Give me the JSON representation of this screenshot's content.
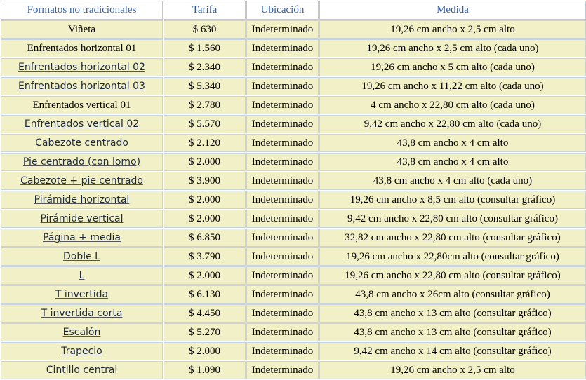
{
  "headers": [
    "Formatos no tradicionales",
    "Tarifa",
    "Ubicación",
    "Medida"
  ],
  "rows": [
    {
      "name": "Viñeta",
      "linked": false,
      "price": "$ 630",
      "location": "Indeterminado",
      "size": "19,26 cm ancho x 2,5 cm alto"
    },
    {
      "name": "Enfrentados horizontal 01",
      "linked": false,
      "price": "$ 1.560",
      "location": "Indeterminado",
      "size": "19,26 cm ancho x 2,5 cm alto (cada uno)"
    },
    {
      "name": "Enfrentados horizontal 02",
      "linked": true,
      "price": "$ 2.340",
      "location": "Indeterminado",
      "size": "19,26 cm ancho x 5 cm alto (cada uno)"
    },
    {
      "name": "Enfrentados horizontal 03",
      "linked": true,
      "price": "$ 5.340",
      "location": "Indeterminado",
      "size": "19,26 cm ancho x 11,22 cm alto (cada uno)"
    },
    {
      "name": "Enfrentados vertical 01",
      "linked": false,
      "price": "$ 2.780",
      "location": "Indeterminado",
      "size": "4 cm ancho x 22,80 cm alto (cada uno)"
    },
    {
      "name": "Enfrentados vertical 02",
      "linked": true,
      "price": "$ 5.570",
      "location": "Indeterminado",
      "size": "9,42 cm ancho x 22,80 cm alto (cada uno)"
    },
    {
      "name": "Cabezote centrado",
      "linked": true,
      "price": "$ 2.120",
      "location": "Indeterminado",
      "size": "43,8 cm ancho x 4 cm alto"
    },
    {
      "name": "Pie centrado (con lomo)",
      "linked": true,
      "price": "$ 2.000",
      "location": "Indeterminado",
      "size": "43,8 cm ancho x 4 cm alto"
    },
    {
      "name": "Cabezote + pie centrado",
      "linked": true,
      "price": "$ 3.900",
      "location": "Indeterminado",
      "size": "43,8 cm ancho x 4 cm alto (cada uno)"
    },
    {
      "name": "Pirámide horizontal",
      "linked": true,
      "price": "$ 2.000",
      "location": "Indeterminado",
      "size": "19,26 cm ancho x 8,5 cm alto (consultar gráfico)"
    },
    {
      "name": "Pirámide vertical",
      "linked": true,
      "price": "$ 2.000",
      "location": "Indeterminado",
      "size": "9,42 cm ancho x 22,80 cm alto (consultar gráfico)"
    },
    {
      "name": "Página + media",
      "linked": true,
      "price": "$ 6.850",
      "location": "Indeterminado",
      "size": "32,82 cm ancho x 22,80 cm alto (consultar gráfico)"
    },
    {
      "name": "Doble L",
      "linked": true,
      "price": "$ 3.790",
      "location": "Indeterminado",
      "size": "19,26 cm ancho x 22,80cm alto (consultar gráfico)"
    },
    {
      "name": "L",
      "linked": true,
      "price": "$ 2.000",
      "location": "Indeterminado",
      "size": "19,26 cm ancho x 22,80 cm alto (consultar gráfico)"
    },
    {
      "name": "T invertida",
      "linked": true,
      "price": "$ 6.130",
      "location": "Indeterminado",
      "size": "43,8 cm ancho x 26cm alto (consultar gráfico)"
    },
    {
      "name": "T invertida corta",
      "linked": true,
      "price": "$ 4.450",
      "location": "Indeterminado",
      "size": "43,8 cm ancho x 13 cm alto (consultar gráfico)"
    },
    {
      "name": "Escalón",
      "linked": true,
      "price": "$ 5.270",
      "location": "Indeterminado",
      "size": "43,8 cm ancho x 13 cm alto (consultar gráfico)"
    },
    {
      "name": "Trapecio",
      "linked": true,
      "price": "$ 2.000",
      "location": "Indeterminado",
      "size": "9,42 cm ancho x 14 cm alto (consultar gráfico)"
    },
    {
      "name": "Cintillo central",
      "linked": true,
      "price": "$ 1.090",
      "location": "Indeterminado",
      "size": "19,26 cm ancho x 2,5 cm alto"
    }
  ],
  "colors": {
    "header_text": "#2e5fa8",
    "cell_background": "#f2f0c7",
    "link_text": "#1e2a40"
  }
}
